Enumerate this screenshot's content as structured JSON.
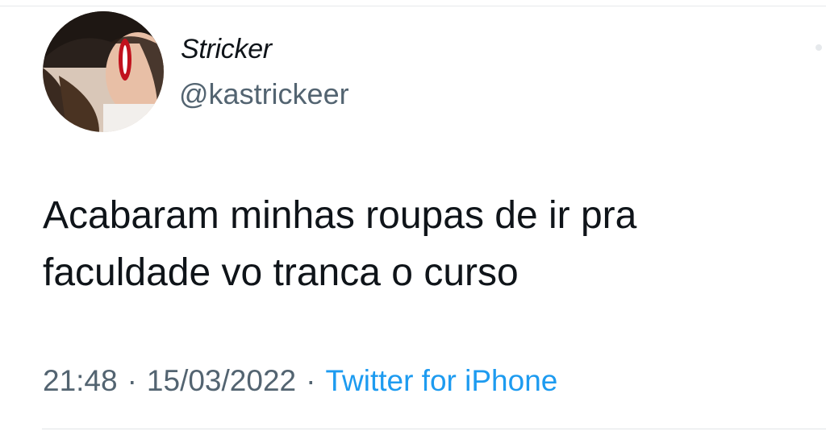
{
  "user": {
    "display_name": "Stricker",
    "handle": "@kastrickeer",
    "avatar_icon": "profile-photo"
  },
  "tweet": {
    "text_line1": "Acabaram minhas roupas de ir pra",
    "text_line2": "faculdade vo tranca o curso"
  },
  "meta": {
    "time": "21:48",
    "separator": "·",
    "date": "15/03/2022",
    "source": "Twitter for iPhone"
  },
  "colors": {
    "text": "#0f1419",
    "secondary": "#536471",
    "link": "#1d9bf0"
  }
}
